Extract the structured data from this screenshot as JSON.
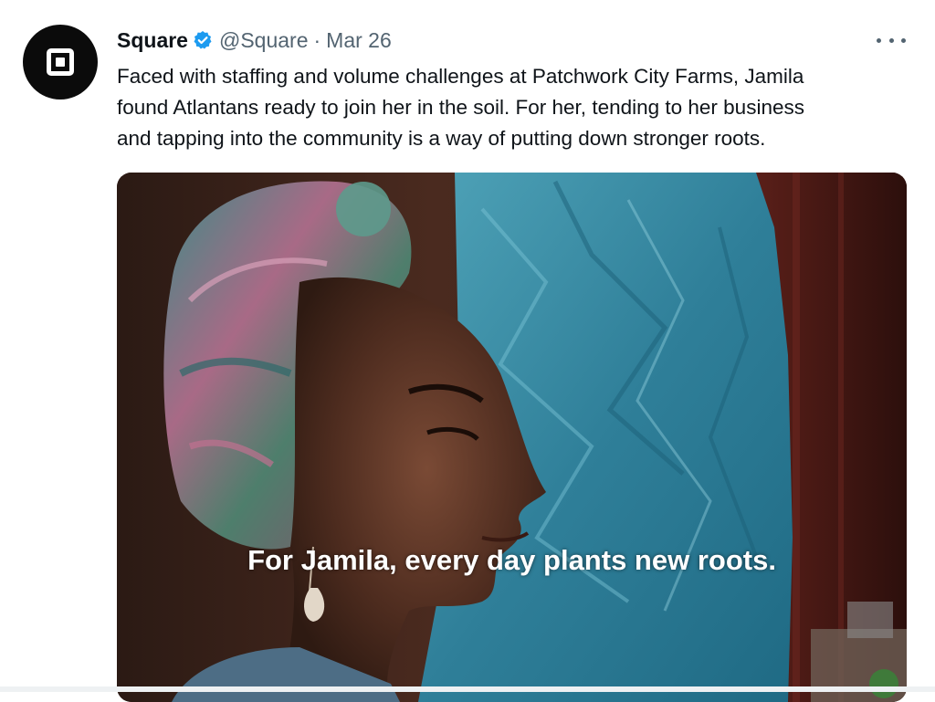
{
  "tweet": {
    "author": {
      "display_name": "Square",
      "verified": true,
      "handle": "@Square",
      "separator": "·",
      "date": "Mar 26",
      "avatar_icon": "square-logo-icon"
    },
    "more_icon": "more-options-icon",
    "text_lines": [
      "Faced with staffing and volume challenges at Patchwork City Farms, Jamila",
      "found Atlantans ready to join her in the soil. For her, tending to her business",
      "and tapping into the community is a way of putting down stronger roots."
    ],
    "media": {
      "type": "video",
      "caption": "For Jamila, every day plants new roots."
    }
  },
  "colors": {
    "text": "#0f1419",
    "secondary_text": "#536471",
    "verified_blue": "#1d9bf0",
    "avatar_background": "#0b0b0b"
  }
}
